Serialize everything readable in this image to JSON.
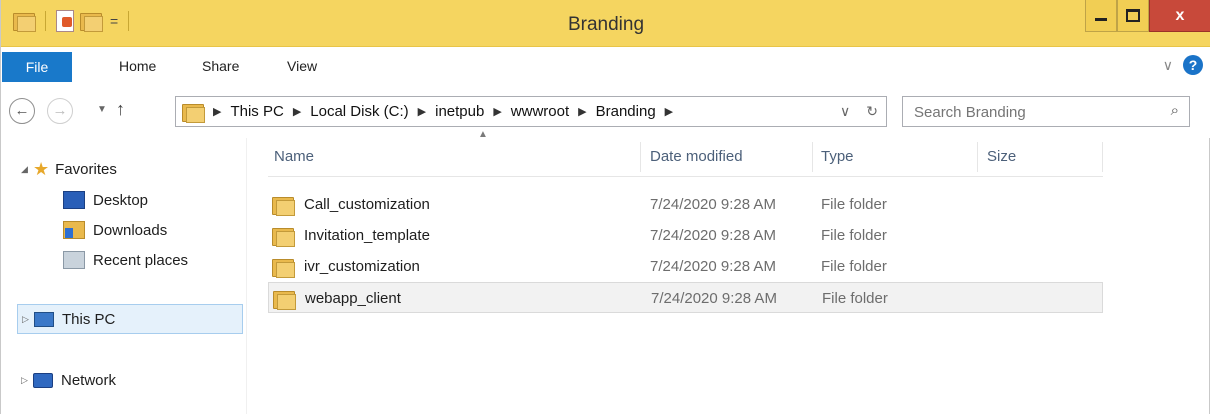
{
  "window": {
    "title": "Branding",
    "close_glyph": "x",
    "accent": "#f5d560"
  },
  "quick_access": {
    "dropdown_glyph": "="
  },
  "ribbon": {
    "tabs": [
      "File",
      "Home",
      "Share",
      "View"
    ],
    "collapse_glyph": "∨",
    "help_glyph": "?"
  },
  "nav": {
    "back_glyph": "←",
    "forward_glyph": "→",
    "recent_glyph": "▼",
    "up_glyph": "↑",
    "breadcrumb": [
      "This PC",
      "Local Disk (C:)",
      "inetpub",
      "wwwroot",
      "Branding"
    ],
    "dropdown_glyph": "∨",
    "refresh_glyph": "↻",
    "search_placeholder": "Search Branding",
    "search_glyph": "⌕"
  },
  "navpane": {
    "favorites": "Favorites",
    "favorite_items": [
      "Desktop",
      "Downloads",
      "Recent places"
    ],
    "this_pc": "This PC",
    "network": "Network"
  },
  "columns": {
    "name": "Name",
    "date": "Date modified",
    "type": "Type",
    "size": "Size"
  },
  "files": [
    {
      "name": "Call_customization",
      "date": "7/24/2020 9:28 AM",
      "type": "File folder"
    },
    {
      "name": "Invitation_template",
      "date": "7/24/2020 9:28 AM",
      "type": "File folder"
    },
    {
      "name": "ivr_customization",
      "date": "7/24/2020 9:28 AM",
      "type": "File folder"
    },
    {
      "name": "webapp_client",
      "date": "7/24/2020 9:28 AM",
      "type": "File folder"
    }
  ]
}
